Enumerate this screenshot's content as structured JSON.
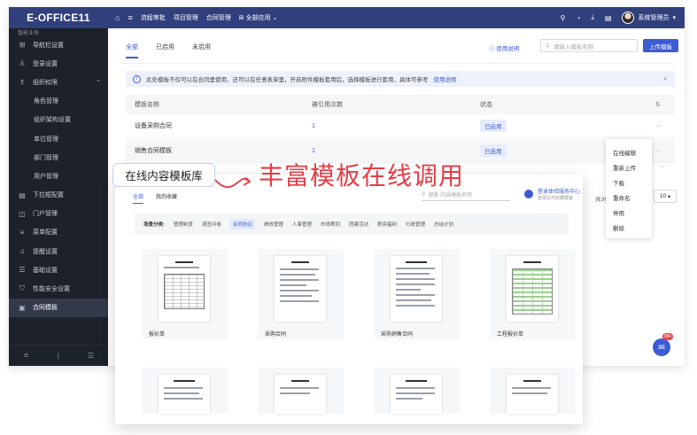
{
  "app": {
    "brand": "E-OFFICE11",
    "top_nav": [
      "流程审批",
      "项目管理",
      "合同管理",
      "全部应用"
    ],
    "user_name": "系统管理员"
  },
  "sidebar": {
    "top_cut": "智能业务",
    "items": [
      {
        "label": "导航栏设置",
        "icon": "grid-icon"
      },
      {
        "label": "登录设置",
        "icon": "user-icon"
      },
      {
        "label": "组织权限",
        "icon": "users-icon",
        "expanded": true
      },
      {
        "label": "角色管理",
        "sub": true
      },
      {
        "label": "组织架构设置",
        "sub": true
      },
      {
        "label": "单位管理",
        "sub": true
      },
      {
        "label": "部门管理",
        "sub": true
      },
      {
        "label": "用户管理",
        "sub": true
      },
      {
        "label": "下拉框配置",
        "icon": "list-icon"
      },
      {
        "label": "门户管理",
        "icon": "portal-icon"
      },
      {
        "label": "菜单配置",
        "icon": "menu-icon"
      },
      {
        "label": "提醒设置",
        "icon": "bell-icon"
      },
      {
        "label": "基础设置",
        "icon": "settings-icon"
      },
      {
        "label": "性能安全设置",
        "icon": "shield-icon"
      },
      {
        "label": "合同模板",
        "icon": "contract-icon",
        "active": true
      }
    ]
  },
  "content": {
    "tabs": [
      "全部",
      "已启用",
      "未启用"
    ],
    "help": "使用说明",
    "search_placeholder": "请输入模板名称",
    "upload_label": "上传模板",
    "notice": "此处模板不仅可以在合同里使用，还可以在任意表单里，开启附件模板套用后，选择模板进行套用，具体可参考",
    "notice_link": "使用说明",
    "columns": [
      "模板名称",
      "被引用次数",
      "状态"
    ],
    "rows": [
      {
        "name": "设备采购合同",
        "count": "1",
        "status": "已启用"
      },
      {
        "name": "销售合同模板",
        "count": "1",
        "status": "已启用"
      }
    ],
    "more": "···",
    "dropdown": [
      "在线编辑",
      "重新上传",
      "下载",
      "重命名",
      "停用",
      "删除"
    ],
    "total": "共3条",
    "page_size": "10",
    "chat_badge": "99+"
  },
  "library": {
    "tabs": [
      "全部",
      "我的收藏"
    ],
    "search_placeholder": "搜索  内容模板名称",
    "login_title": "登录体验服务中心",
    "login_sub": "登录后可收藏模板",
    "category_label": "场景分类:",
    "categories": [
      "管理制度",
      "调查问卷",
      "合同协议",
      "绩效管理",
      "人事管理",
      "市场策划",
      "团建活动",
      "薪资福利",
      "行政管理",
      "总结计划"
    ],
    "cards": [
      "报价单",
      "采购合同",
      "采购销售合同",
      "工程报价单"
    ]
  },
  "callout": "在线内容模板库",
  "headline": "丰富模板在线调用",
  "colors": {
    "accent": "#3e5bd6",
    "topbar": "#30407c",
    "sidebar": "#1d2129",
    "headline": "#e53d47"
  }
}
